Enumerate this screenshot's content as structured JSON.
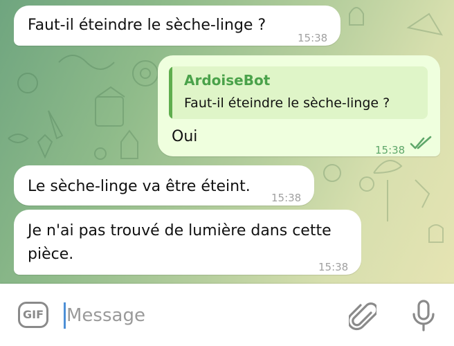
{
  "messages": {
    "m1": {
      "text": "Faut-il éteindre le sèche-linge ?",
      "time": "15:38"
    },
    "m2": {
      "reply_to": {
        "author": "ArdoiseBot",
        "text": "Faut-il éteindre le sèche-linge ?"
      },
      "text": "Oui",
      "time": "15:38",
      "status_icon": "double-check-icon"
    },
    "m3": {
      "text": "Le sèche-linge va être éteint.",
      "time": "15:38"
    },
    "m4": {
      "text": "Je n'ai pas trouvé de lumière dans cette pièce.",
      "time": "15:38"
    }
  },
  "input_bar": {
    "gif_label": "GIF",
    "placeholder": "Message",
    "attach_icon": "paperclip-icon",
    "mic_icon": "microphone-icon"
  },
  "colors": {
    "outgoing_bubble": "#efffde",
    "incoming_bubble": "#ffffff",
    "accent_green": "#4aa24a",
    "caret_blue": "#4d8fd6"
  }
}
